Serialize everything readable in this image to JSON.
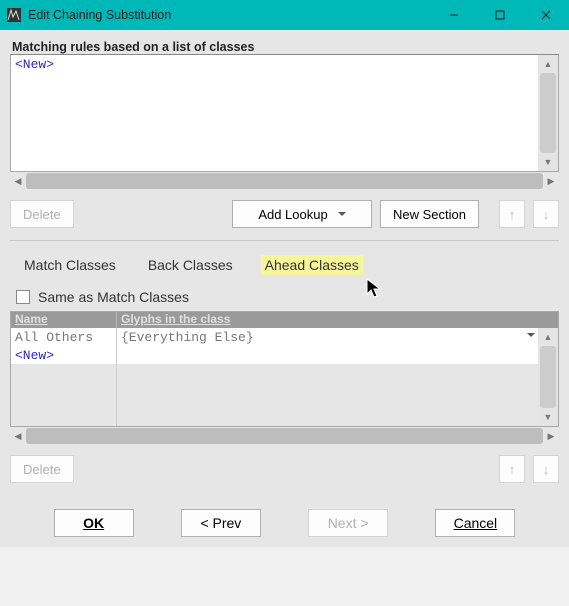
{
  "window": {
    "title": "Edit Chaining Substitution"
  },
  "top": {
    "label": "Matching rules based on a list of classes",
    "new_item": "<New>",
    "delete_label": "Delete",
    "add_lookup_label": "Add Lookup",
    "new_section_label": "New Section"
  },
  "tabs": {
    "match": "Match Classes",
    "back": "Back Classes",
    "ahead": "Ahead Classes"
  },
  "checkbox": {
    "same_label": "Same as Match Classes"
  },
  "table": {
    "header_name": "Name",
    "header_glyphs": "Glyphs in the class",
    "rows": [
      {
        "name": "All Others",
        "glyphs": "{Everything Else}"
      },
      {
        "name": "<New>",
        "glyphs": ""
      }
    ]
  },
  "lower": {
    "delete_label": "Delete"
  },
  "footer": {
    "ok": "OK",
    "prev": "< Prev",
    "next": "Next >",
    "cancel": "Cancel"
  },
  "icons": {
    "up_arrow": "↑",
    "down_arrow": "↓",
    "tri_up": "▲",
    "tri_down": "▼",
    "tri_left": "◀",
    "tri_right": "▶"
  }
}
